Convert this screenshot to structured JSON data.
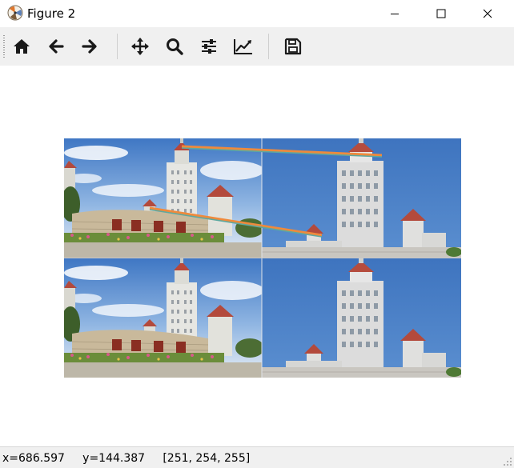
{
  "window": {
    "title": "Figure 2"
  },
  "icons": {
    "app": "matplotlib-icon",
    "minimize": "minimize-icon",
    "maximize": "maximize-icon",
    "close": "close-icon"
  },
  "toolbar": {
    "tools": [
      {
        "name": "home",
        "icon": "home-icon"
      },
      {
        "name": "back",
        "icon": "arrow-left-icon"
      },
      {
        "name": "forward",
        "icon": "arrow-right-icon"
      },
      {
        "name": "pan",
        "icon": "move-icon"
      },
      {
        "name": "zoom",
        "icon": "magnifier-icon"
      },
      {
        "name": "configure-subplots",
        "icon": "sliders-icon"
      },
      {
        "name": "edit-axes",
        "icon": "line-chart-icon"
      },
      {
        "name": "save",
        "icon": "floppy-disk-icon"
      }
    ]
  },
  "figure": {
    "panels": [
      "left-image",
      "right-image",
      "left-image-bottom",
      "right-image-bottom"
    ],
    "match_line_colors": [
      "#ef8a3c",
      "#5fa89e"
    ],
    "sky_color": "#4f86c9"
  },
  "statusbar": {
    "coordinates": "x=686.597     y=144.387     [251, 254, 255]"
  }
}
